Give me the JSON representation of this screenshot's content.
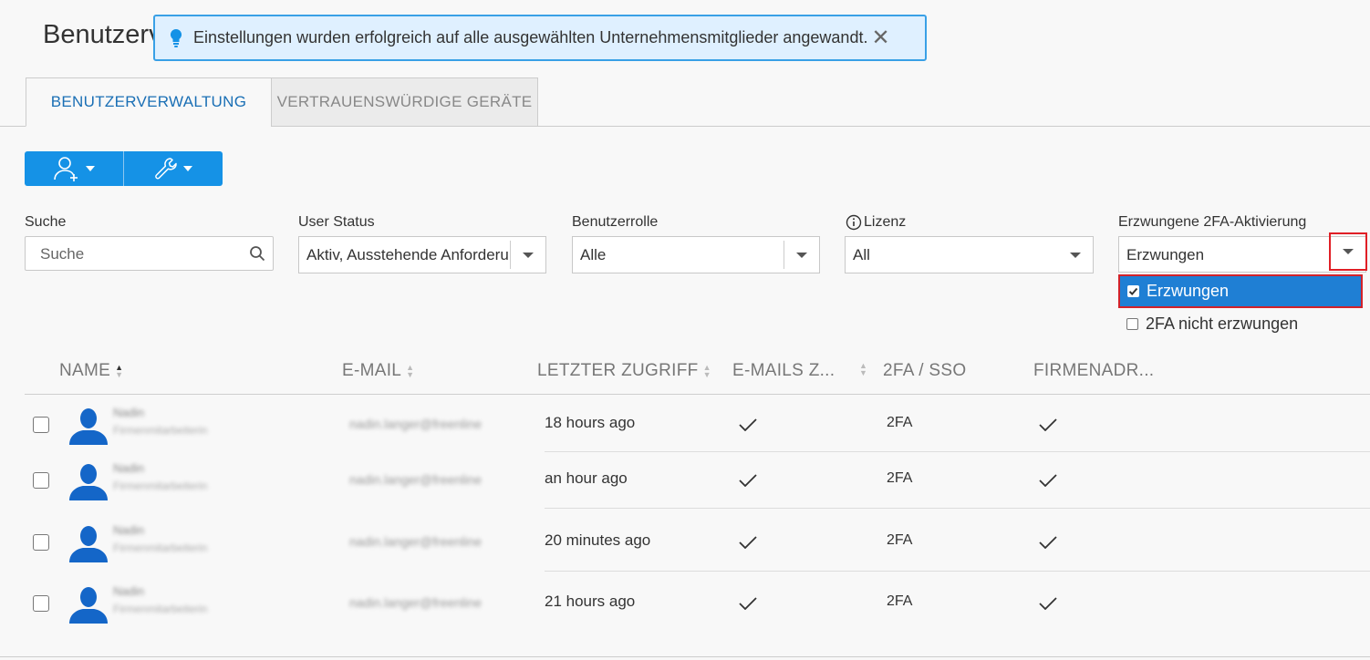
{
  "page": {
    "title": "Benutzerverwaltung"
  },
  "notification": {
    "message": "Einstellungen wurden erfolgreich auf alle ausgewählten Unternehmensmitglieder angewandt.",
    "close": "✕"
  },
  "tabs": [
    {
      "label": "BENUTZERVERWALTUNG",
      "active": true
    },
    {
      "label": "VERTRAUENSWÜRDIGE GERÄTE",
      "active": false
    }
  ],
  "toolbar": {
    "add_user_icon": "add-user-icon",
    "tools_icon": "wrench-icon"
  },
  "filters": {
    "search": {
      "label": "Suche",
      "placeholder": "Suche"
    },
    "user_status": {
      "label": "User Status",
      "value": "Aktiv, Ausstehende Anforderung"
    },
    "role": {
      "label": "Benutzerrolle",
      "value": "Alle"
    },
    "license": {
      "label": "Lizenz",
      "value": "All"
    },
    "twofa": {
      "label": "Erzwungene 2FA-Aktivierung",
      "value": "Erzwungen",
      "options": [
        {
          "label": "Erzwungen",
          "checked": true
        },
        {
          "label": "2FA nicht erzwungen",
          "checked": false
        }
      ]
    }
  },
  "table": {
    "columns": [
      "NAME",
      "E-MAIL",
      "LETZTER ZUGRIFF",
      "E-MAILS Z...",
      "2FA / SSO",
      "FIRMENADR..."
    ],
    "rows": [
      {
        "name": "Nadin",
        "subtitle": "Firmenmitarbeiterin",
        "email": "nadin.langer@freenline",
        "last_access": "18 hours ago",
        "twofa": "2FA"
      },
      {
        "name": "Nadin",
        "subtitle": "Firmenmitarbeiterin",
        "email": "nadin.langer@freenline",
        "last_access": "an hour ago",
        "twofa": "2FA"
      },
      {
        "name": "Nadin",
        "subtitle": "Firmenmitarbeiterin",
        "email": "nadin.langer@freenline",
        "last_access": "20 minutes ago",
        "twofa": "2FA"
      },
      {
        "name": "Nadin",
        "subtitle": "Firmenmitarbeiterin",
        "email": "nadin.langer@freenline",
        "last_access": "21 hours ago",
        "twofa": "2FA"
      }
    ]
  },
  "colors": {
    "accent": "#1592e6",
    "highlight": "#e01f26",
    "avatar": "#1466c8"
  }
}
